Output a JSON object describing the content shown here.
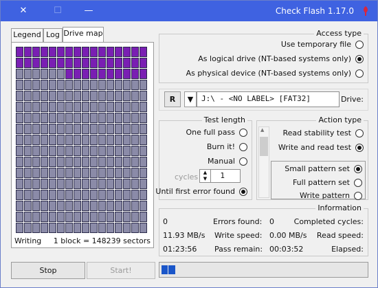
{
  "window": {
    "title": "Check Flash 1.17.0"
  },
  "tabs": [
    "Drive map",
    "Log",
    "Legend"
  ],
  "map_footer": {
    "block_info": "1 block = 148239 sectors",
    "status": "Writing"
  },
  "buttons": {
    "stop": "Stop",
    "start": "Start!"
  },
  "access_type": {
    "title": "Access type",
    "options": [
      "Use temporary file",
      "As logical drive (NT-based systems only)",
      "As physical device (NT-based systems only)"
    ],
    "selected_index": 1
  },
  "drive": {
    "label": "Drive:",
    "value": "J:\\ - <NO LABEL> [FAT32]",
    "refresh_label": "R"
  },
  "action_type": {
    "title": "Action type",
    "options": [
      "Read stability test",
      "Write and read test"
    ],
    "selected_index": 1,
    "patterns": [
      "Small pattern set",
      "Full pattern set",
      "Write pattern"
    ],
    "pattern_selected_index": 0
  },
  "test_length": {
    "title": "Test length",
    "options": [
      "One full pass",
      "Burn it!",
      "Manual"
    ],
    "cycles_value": "1",
    "cycles_label": "cycles",
    "until_error": "Until first error found",
    "selected": "until_error"
  },
  "information": {
    "title": "Information",
    "completed_cycles_label": "Completed cycles:",
    "completed_cycles": "0",
    "errors_found_label": "Errors found:",
    "errors_found": "0",
    "read_speed_label": "Read speed:",
    "read_speed": "0.00 MB/s",
    "write_speed_label": "Write speed:",
    "write_speed": "11.93 MB/s",
    "elapsed_label": "Elapsed:",
    "elapsed": "00:03:52",
    "pass_remain_label": "Pass remain:",
    "pass_remain": "01:23:56"
  },
  "drive_map": {
    "rows": 17,
    "cols": 16,
    "written_blocks": 42
  },
  "colors": {
    "titlebar": "#3f62e1",
    "written": "#7a1fb3",
    "pending": "#8b8ba8"
  }
}
